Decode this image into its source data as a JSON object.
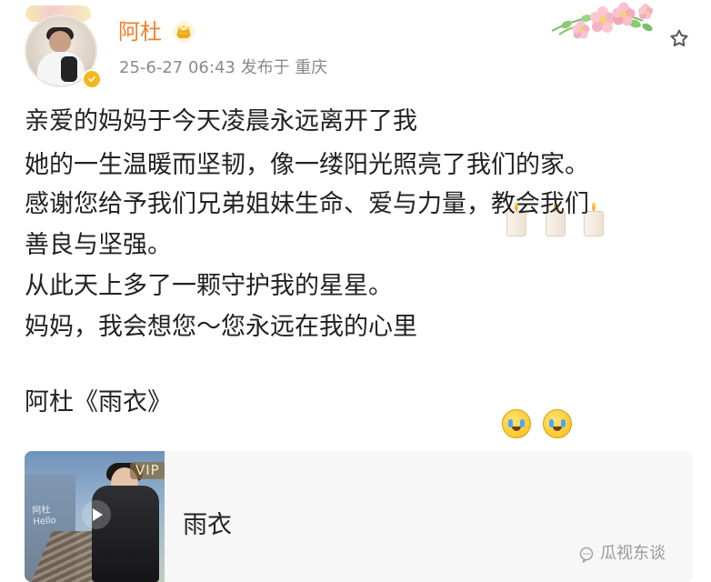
{
  "post": {
    "author": "阿杜",
    "meta": "25-6-27 06:43  发布于  重庆",
    "lines": [
      "亲爱的妈妈于今天凌晨永远离开了我",
      "她的一生温暖而坚韧，像一缕阳光照亮了我们的家。",
      "感谢您给予我们兄弟姐妹生命、爱与力量，教会我们",
      "善良与坚强。",
      "从此天上多了一颗守护我的星星。",
      "妈妈，我会想您～您永远在我的心里",
      "阿杜《雨衣》"
    ],
    "media_card": {
      "title": "雨衣",
      "badge": "VIP",
      "cover_text_line1": "阿杜",
      "cover_text_line2": "Hello"
    },
    "watermark": "瓜视东谈"
  },
  "icons": {
    "crown": "crown-icon",
    "star": "star-icon",
    "play": "play-icon",
    "verified": "verified-icon",
    "candle": "candle-icon",
    "cry": "crying-face-icon",
    "watermark": "chat-bubble-icon"
  },
  "colors": {
    "username": "#f07f2f",
    "meta": "#8a8a8a",
    "card_background": "#f7f7f7",
    "watermark": "#8a8a8a"
  }
}
